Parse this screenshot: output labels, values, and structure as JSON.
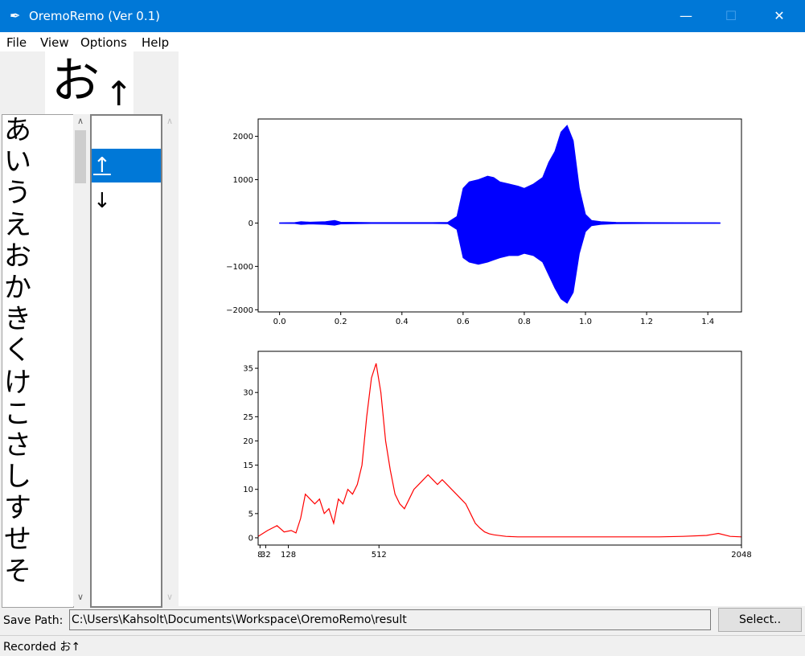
{
  "window": {
    "title": "OremoRemo (Ver 0.1)",
    "app_icon": "feather-icon",
    "minimize_glyph": "—",
    "maximize_glyph": "☐",
    "close_glyph": "✕"
  },
  "menu": [
    "File",
    "View",
    "Options",
    "Help"
  ],
  "current": {
    "kana": "お",
    "direction": "↑"
  },
  "kana_list": [
    "あ",
    "い",
    "う",
    "え",
    "お",
    "か",
    "き",
    "く",
    "け",
    "こ",
    "さ",
    "し",
    "す",
    "せ",
    "そ"
  ],
  "direction_list": {
    "items": [
      "↑",
      "↓"
    ],
    "selected_index": 0
  },
  "scroll_glyphs": {
    "up": "∧",
    "down": "∨"
  },
  "save": {
    "label": "Save Path:",
    "value": "C:\\Users\\Kahsolt\\Documents\\Workspace\\OremoRemo\\result",
    "button": "Select.."
  },
  "status": "Recorded お↑",
  "colors": {
    "accent": "#0078d7",
    "waveform": "#0000ff",
    "spectrum": "#ff0000"
  },
  "chart_data": [
    {
      "type": "line",
      "title": "",
      "xlabel": "",
      "ylabel": "",
      "xlim": [
        -0.07,
        1.51
      ],
      "ylim": [
        -2050,
        2400
      ],
      "xticks": [
        0.0,
        0.2,
        0.4,
        0.6,
        0.8,
        1.0,
        1.2,
        1.4
      ],
      "xtick_labels": [
        "0.0",
        "0.2",
        "0.4",
        "0.6",
        "0.8",
        "1.0",
        "1.2",
        "1.4"
      ],
      "yticks": [
        -2000,
        -1000,
        0,
        1000,
        2000
      ],
      "ytick_labels": [
        "−2000",
        "−1000",
        "0",
        "1000",
        "2000"
      ],
      "grid": false,
      "series": [
        {
          "style": "waveform-envelope",
          "x": [
            0.0,
            0.05,
            0.07,
            0.1,
            0.15,
            0.18,
            0.2,
            0.3,
            0.4,
            0.5,
            0.55,
            0.58,
            0.6,
            0.62,
            0.65,
            0.68,
            0.7,
            0.72,
            0.75,
            0.78,
            0.8,
            0.83,
            0.86,
            0.88,
            0.9,
            0.92,
            0.94,
            0.96,
            0.98,
            1.0,
            1.02,
            1.05,
            1.1,
            1.2,
            1.3,
            1.44
          ],
          "upper": [
            5,
            10,
            30,
            20,
            30,
            60,
            20,
            10,
            10,
            10,
            15,
            150,
            800,
            950,
            1000,
            1080,
            1050,
            950,
            900,
            850,
            800,
            900,
            1050,
            1400,
            1650,
            2100,
            2250,
            1900,
            800,
            200,
            60,
            30,
            15,
            10,
            8,
            5
          ],
          "lower": [
            -5,
            -10,
            -30,
            -20,
            -30,
            -50,
            -20,
            -10,
            -10,
            -10,
            -15,
            -150,
            -800,
            -900,
            -950,
            -900,
            -850,
            -800,
            -750,
            -750,
            -700,
            -750,
            -900,
            -1200,
            -1500,
            -1750,
            -1850,
            -1600,
            -700,
            -200,
            -60,
            -30,
            -15,
            -10,
            -8,
            -5
          ]
        }
      ]
    },
    {
      "type": "line",
      "title": "",
      "xlabel": "",
      "ylabel": "",
      "xlim": [
        0,
        2048
      ],
      "ylim": [
        -1.5,
        38.5
      ],
      "xticks": [
        8,
        32,
        128,
        512,
        2048
      ],
      "xtick_labels": [
        "8",
        "32",
        "128",
        "512",
        "2048"
      ],
      "yticks": [
        0,
        5,
        10,
        15,
        20,
        25,
        30,
        35
      ],
      "ytick_labels": [
        "0",
        "5",
        "10",
        "15",
        "20",
        "25",
        "30",
        "35"
      ],
      "grid": false,
      "series": [
        {
          "x": [
            0,
            40,
            80,
            110,
            140,
            160,
            180,
            200,
            220,
            240,
            260,
            280,
            300,
            320,
            340,
            360,
            380,
            400,
            420,
            440,
            460,
            480,
            500,
            520,
            540,
            560,
            580,
            600,
            620,
            640,
            660,
            680,
            700,
            720,
            740,
            760,
            780,
            800,
            820,
            840,
            860,
            880,
            900,
            920,
            940,
            960,
            980,
            1000,
            1050,
            1100,
            1200,
            1300,
            1400,
            1500,
            1600,
            1700,
            1800,
            1900,
            1950,
            2000,
            2048
          ],
          "y": [
            0.3,
            1.5,
            2.5,
            1.2,
            1.5,
            1.0,
            4,
            9,
            8,
            7,
            8,
            5,
            6,
            3,
            8,
            7,
            10,
            9,
            11,
            15,
            25,
            33,
            36,
            30,
            20,
            14,
            9,
            7,
            6,
            8,
            10,
            11,
            12,
            13,
            12,
            11,
            12,
            11,
            10,
            9,
            8,
            7,
            5,
            3,
            2,
            1.2,
            0.8,
            0.6,
            0.3,
            0.2,
            0.2,
            0.2,
            0.2,
            0.2,
            0.2,
            0.2,
            0.3,
            0.5,
            0.9,
            0.3,
            0.2
          ]
        }
      ]
    }
  ]
}
